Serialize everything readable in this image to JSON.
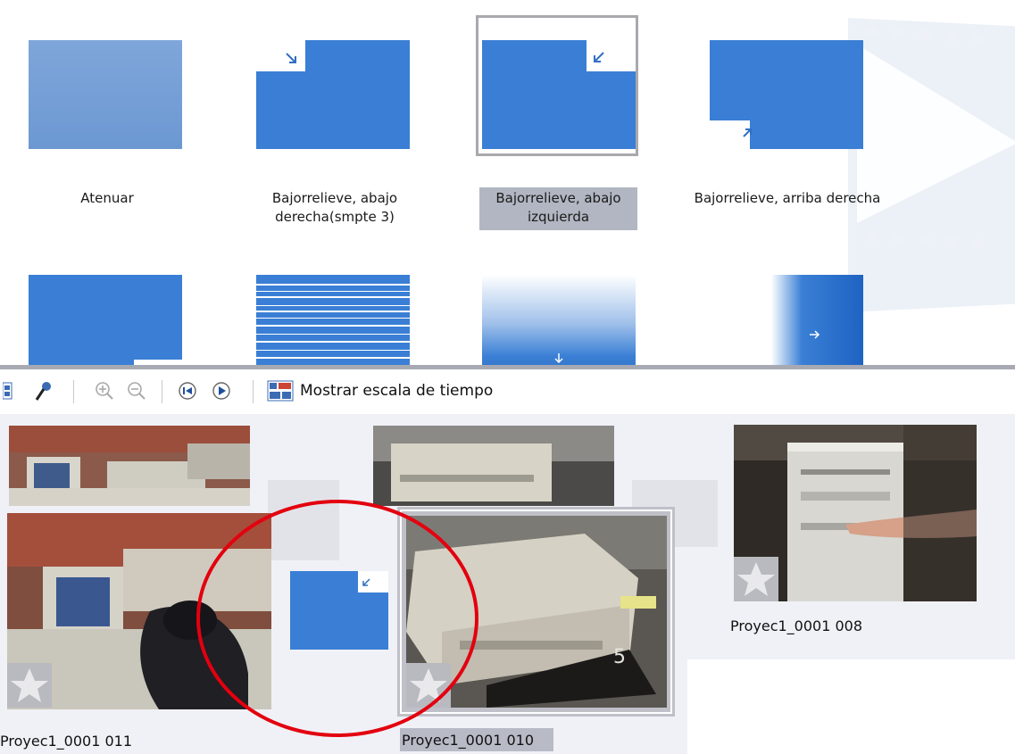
{
  "transitions": [
    {
      "label_1": "Atenuar",
      "label_2": "",
      "icon": "fade-tile"
    },
    {
      "label_1": "Bajorrelieve, abajo",
      "label_2": "derecha(smpte 3)",
      "icon": "emboss-down-right-tile"
    },
    {
      "label_1": "Bajorrelieve, abajo",
      "label_2": "izquierda",
      "icon": "emboss-down-left-tile",
      "selected": true
    },
    {
      "label_1": "Bajorrelieve, arriba derecha",
      "label_2": "",
      "icon": "emboss-up-right-tile"
    }
  ],
  "toolbar": {
    "timeline_label": "Mostrar escala de tiempo",
    "icons": [
      "storyboard-icon",
      "narrate-microphone-icon",
      "zoom-in-icon",
      "zoom-out-icon",
      "rewind-icon",
      "play-icon",
      "timeline-toggle-icon"
    ]
  },
  "clips": {
    "clip_011": "Proyec1_0001 011",
    "clip_010": "Proyec1_0001 010",
    "clip_008": "Proyec1_0001 008"
  },
  "colors": {
    "tile_blue": "#3a7fd5",
    "tile_light": "#7aa3da",
    "selection_gray": "#a9a9ad",
    "storyboard_bg": "#f0f1f6",
    "annotation_red": "#e3000f"
  }
}
